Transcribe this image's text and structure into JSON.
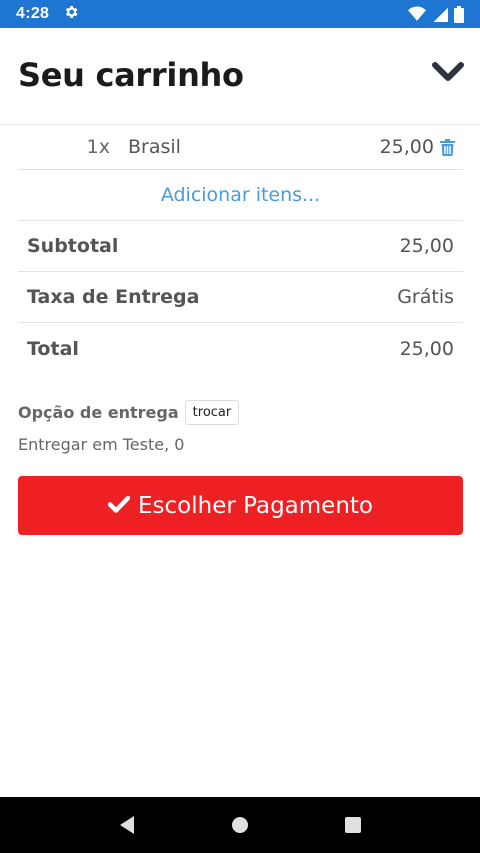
{
  "status_bar": {
    "time": "4:28",
    "icons": [
      "settings-gear-icon",
      "wifi-icon",
      "cell-signal-icon",
      "battery-icon"
    ],
    "color": "#1e76d2"
  },
  "header": {
    "title": "Seu carrinho",
    "collapse_icon": "chevron-down-icon"
  },
  "cart": {
    "items": [
      {
        "qty": "1x",
        "name": "Brasil",
        "price": "25,00",
        "delete_icon": "trash-icon"
      }
    ],
    "add_items_label": "Adicionar itens...",
    "subtotal_label": "Subtotal",
    "subtotal_value": "25,00",
    "delivery_fee_label": "Taxa de Entrega",
    "delivery_fee_value": "Grátis",
    "total_label": "Total",
    "total_value": "25,00"
  },
  "delivery": {
    "label": "Opção de entrega",
    "change_button": "trocar",
    "address": "Entregar em Teste, 0"
  },
  "actions": {
    "pay_button": "Escolher Pagamento",
    "pay_icon": "checkmark-icon",
    "pay_color": "#ee2024"
  },
  "nav_bar": {
    "icons": [
      "back-icon",
      "home-icon",
      "recents-icon"
    ]
  }
}
